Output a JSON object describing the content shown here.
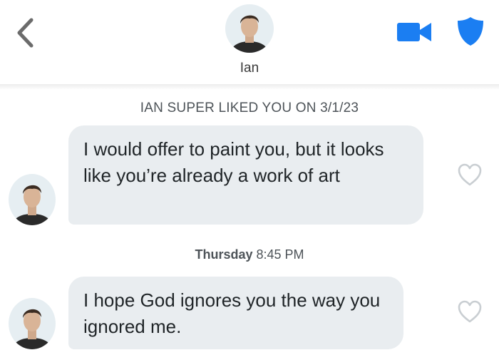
{
  "header": {
    "contact_name": "Ian",
    "back_icon": "chevron-left-icon",
    "video_icon": "video-camera-icon",
    "safety_icon": "shield-icon",
    "accent_color": "#1b7ef2"
  },
  "chat": {
    "super_like_notice": "IAN SUPER LIKED YOU ON 3/1/23",
    "messages": [
      {
        "text": "I would offer to paint you, but it looks like you’re already a work of art",
        "liked": false
      },
      {
        "text": "I hope God ignores you the way you ignored me.",
        "liked": false
      }
    ],
    "day_separator": {
      "day": "Thursday",
      "time": "8:45 PM"
    }
  }
}
